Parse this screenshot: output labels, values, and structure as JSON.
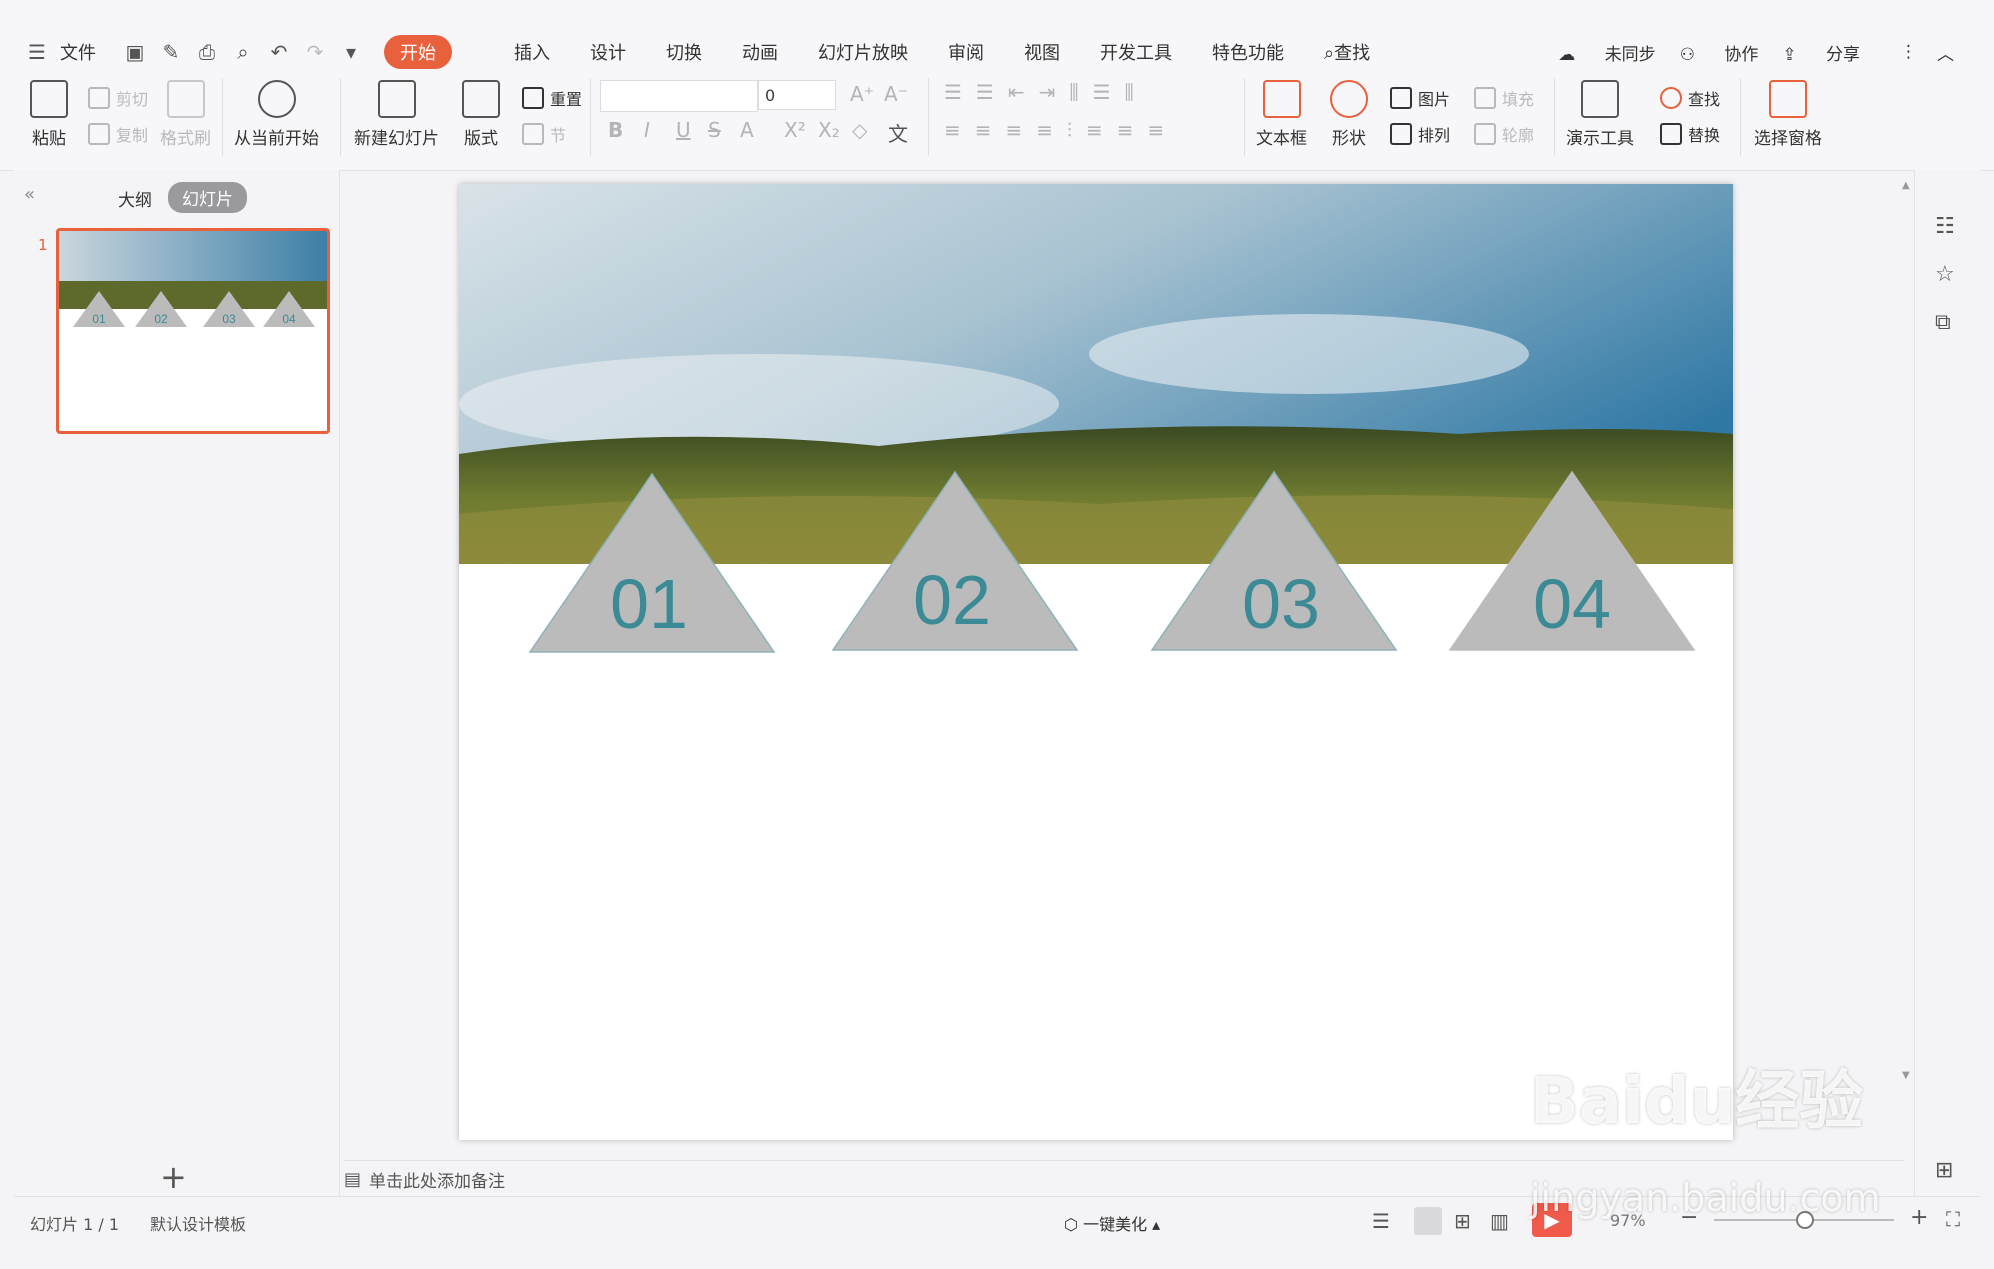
{
  "menu": {
    "file_label": "文件"
  },
  "tabs": [
    "开始",
    "插入",
    "设计",
    "切换",
    "动画",
    "幻灯片放映",
    "审阅",
    "视图",
    "开发工具",
    "特色功能"
  ],
  "search_label": "查找",
  "header_right": {
    "sync": "未同步",
    "collab": "协作",
    "share": "分享"
  },
  "toolbar": {
    "paste": "粘贴",
    "cut": "剪切",
    "copy": "复制",
    "format_painter": "格式刷",
    "play_from_current": "从当前开始",
    "new_slide": "新建幻灯片",
    "layout": "版式",
    "reset": "重置",
    "section": "节",
    "font_size_value": "0",
    "text_box": "文本框",
    "shape": "形状",
    "picture": "图片",
    "fill": "填充",
    "arrange": "排列",
    "outline": "轮廓",
    "presentation_tools": "演示工具",
    "find": "查找",
    "replace": "替换",
    "selection_pane": "选择窗格"
  },
  "left_panel": {
    "tab_outline": "大纲",
    "tab_slides": "幻灯片",
    "slide_number": "1",
    "add_icon": "+"
  },
  "slide": {
    "labels": [
      "01",
      "02",
      "03",
      "04"
    ],
    "label_color": "#3b8a95",
    "triangle_color": "#bbbbbb"
  },
  "notes_placeholder": "单击此处添加备注",
  "status": {
    "slide_counter": "幻灯片 1 / 1",
    "template": "默认设计模板",
    "beautify": "一键美化",
    "zoom": "97%"
  },
  "watermark": {
    "brand": "Baidu经验",
    "url": "jingyan.baidu.com"
  },
  "colors": {
    "accent": "#e8603c",
    "label": "#3b8a95"
  }
}
